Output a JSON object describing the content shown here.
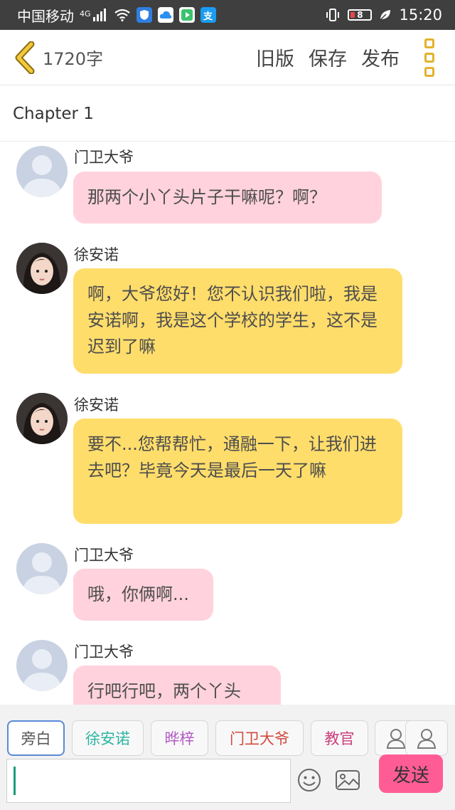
{
  "status_bar": {
    "carrier": "中国移动",
    "network": "4G",
    "battery": "8",
    "time": "15:20",
    "icons": [
      "signal-icon",
      "wifi-icon",
      "shield-app-icon",
      "cloud-app-icon",
      "video-app-icon",
      "alipay-app-icon",
      "vibrate-icon",
      "battery-icon",
      "leaf-icon"
    ]
  },
  "header": {
    "word_count": "1720字",
    "old_version": "旧版",
    "save": "保存",
    "publish": "发布"
  },
  "chapter": {
    "title": "Chapter 1"
  },
  "messages": [
    {
      "name": "门卫大爷",
      "text": "那两个小丫头片子干嘛呢？啊？",
      "avatar": "default",
      "color": "pink"
    },
    {
      "name": "徐安诺",
      "text": "啊，大爷您好！您不认识我们啦，我是安诺啊，我是这个学校的学生，这不是迟到了嘛",
      "avatar": "girl-photo",
      "color": "yellow"
    },
    {
      "name": "徐安诺",
      "text": "要不...您帮帮忙，通融一下，让我们进去吧？毕竟今天是最后一天了嘛",
      "avatar": "girl-photo",
      "color": "yellow"
    },
    {
      "name": "门卫大爷",
      "text": "哦，你俩啊...",
      "avatar": "default",
      "color": "pink"
    },
    {
      "name": "门卫大爷",
      "text": "行吧行吧，两个丫头",
      "avatar": "default",
      "color": "pink"
    }
  ],
  "characters": [
    {
      "label": "旁白",
      "color": "#555555",
      "active": true
    },
    {
      "label": "徐安诺",
      "color": "#2bb5a2",
      "active": false
    },
    {
      "label": "晔梓",
      "color": "#b25ac4",
      "active": false
    },
    {
      "label": "门卫大爷",
      "color": "#d24a3f",
      "active": false
    },
    {
      "label": "教官",
      "color": "#c9417e",
      "active": false
    }
  ],
  "composer": {
    "input_value": "",
    "send_label": "发送"
  },
  "colors": {
    "pink_bubble": "#ffd2dd",
    "yellow_bubble": "#ffdd6b",
    "send_button": "#ff5c95",
    "accent_yellow": "#e3b22c"
  }
}
